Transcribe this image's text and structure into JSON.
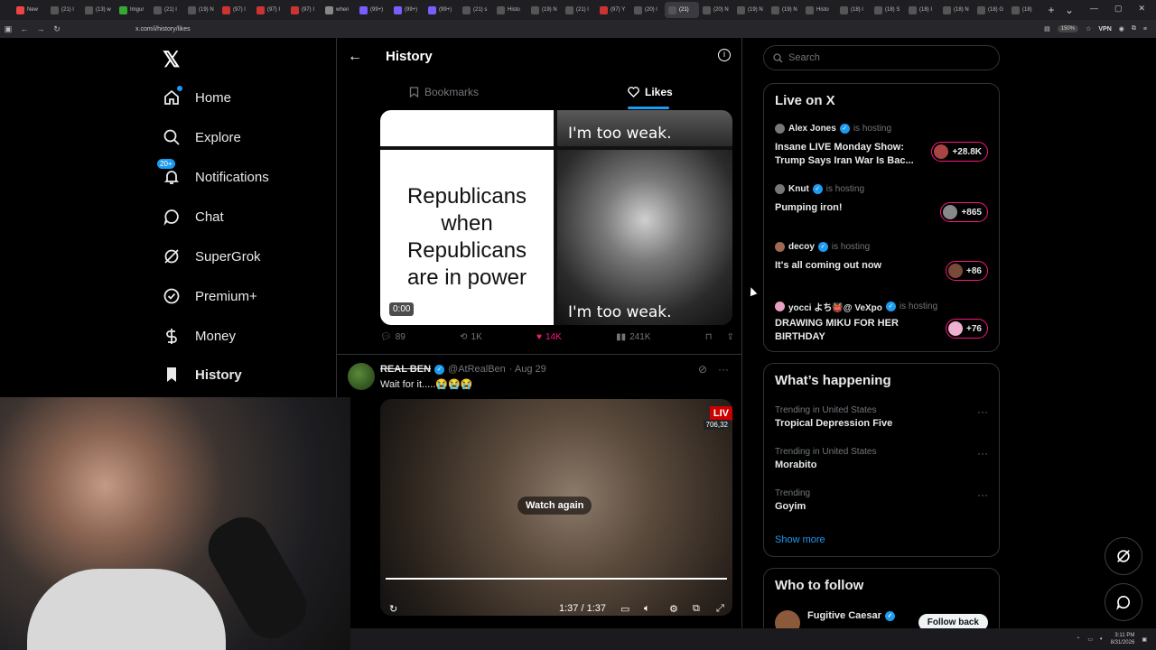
{
  "browser": {
    "tabs": [
      "New",
      "(21) l",
      "(13) w",
      "Imgur",
      "(21) l",
      "(19) N",
      "(97) l",
      "(97) I",
      "(97) I",
      "when",
      "(99+)",
      "(99+)",
      "(99+)",
      "(21) s",
      "Histo",
      "(19) N",
      "(21) l",
      "(97) Y",
      "(20) l",
      "(21)",
      "(20) N",
      "(19) N",
      "(19) N",
      "Histo",
      "(18) l",
      "(18) S",
      "(18) I",
      "(18) N",
      "(18) G",
      "(18)"
    ],
    "url": "x.com/i/history/likes",
    "zoom": "150%",
    "vpn": "VPN"
  },
  "sidebar": {
    "items": [
      {
        "label": "Home"
      },
      {
        "label": "Explore"
      },
      {
        "label": "Notifications",
        "badge": "20+"
      },
      {
        "label": "Chat"
      },
      {
        "label": "SuperGrok"
      },
      {
        "label": "Premium+"
      },
      {
        "label": "Money"
      },
      {
        "label": "History"
      }
    ]
  },
  "header": {
    "title": "History",
    "tabs": [
      {
        "label": "Bookmarks"
      },
      {
        "label": "Likes"
      }
    ]
  },
  "meme": {
    "left_text": "Republicans when Republicans are in power",
    "right_text": "I'm too weak.",
    "time": "0:00"
  },
  "post1_actions": {
    "replies": "89",
    "reposts": "1K",
    "likes": "14K",
    "views": "241K"
  },
  "post2": {
    "name": "REAL BEN",
    "handle": "@AtRealBen",
    "date": "· Aug 29",
    "text": "Wait for it.....😭😭😭",
    "live_tag": "LIV",
    "live_count": "706,32",
    "watch_again": "Watch again",
    "time": "1:37 / 1:37"
  },
  "search": {
    "placeholder": "Search"
  },
  "live": {
    "title": "Live on X",
    "hosting": "is hosting",
    "items": [
      {
        "host": "Alex Jones",
        "title": "Insane LIVE Monday Show: Trump Says Iran War Is Bac...",
        "listeners": "+28.8K"
      },
      {
        "host": "Knut",
        "title": "Pumping iron!",
        "listeners": "+865"
      },
      {
        "host": "decoy",
        "title": "It's all coming out now",
        "listeners": "+86"
      },
      {
        "host": "yocci よち👹@ VeXpo",
        "title": "DRAWING MIKU FOR HER BIRTHDAY",
        "listeners": "+76"
      }
    ]
  },
  "happening": {
    "title": "What’s happening",
    "items": [
      {
        "context": "Trending in United States",
        "name": "Tropical Depression Five"
      },
      {
        "context": "Trending in United States",
        "name": "Morabito"
      },
      {
        "context": "Trending",
        "name": "Goyim"
      }
    ],
    "show_more": "Show more"
  },
  "follow": {
    "title": "Who to follow",
    "name": "Fugitive Caesar",
    "button": "Follow back"
  },
  "taskbar": {
    "time": "3:11 PM",
    "date": "8/31/2026"
  }
}
